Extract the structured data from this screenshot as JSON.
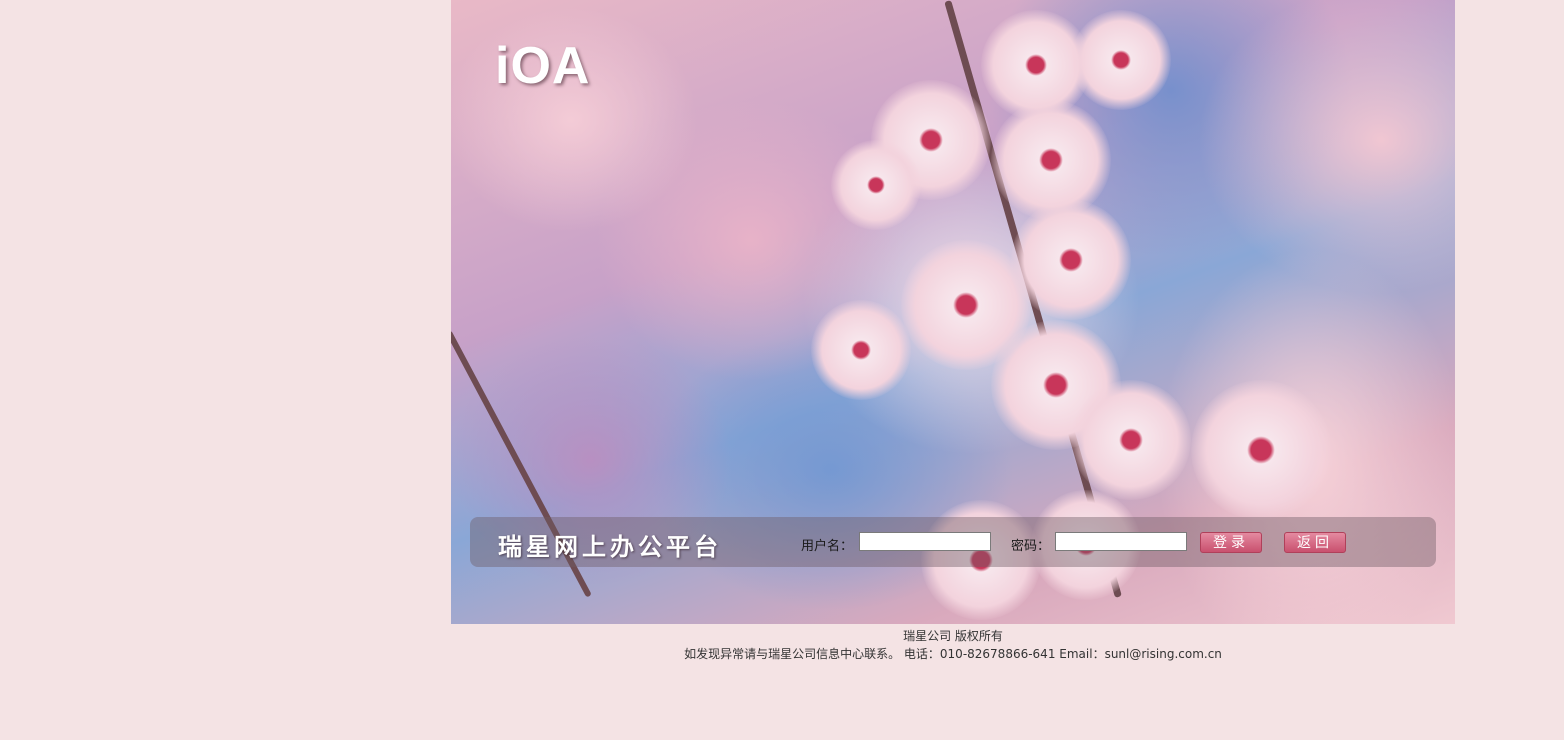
{
  "app": {
    "logo_text": "iOA",
    "platform_title": "瑞星网上办公平台"
  },
  "login": {
    "username_label": "用户名：",
    "username_value": "",
    "password_label": "密码：",
    "password_value": "",
    "login_button": "登录",
    "back_button": "返回"
  },
  "footer": {
    "copyright": "瑞星公司 版权所有",
    "contact": "如发现异常请与瑞星公司信息中心联系。 电话：010-82678866-641 Email：sunl@rising.com.cn"
  },
  "colors": {
    "page_background": "#f4e3e4",
    "button_accent": "#c9506e"
  }
}
